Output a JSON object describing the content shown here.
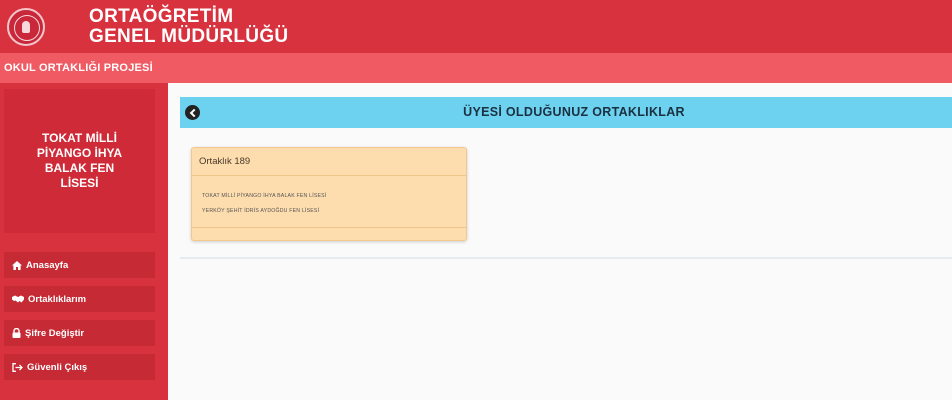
{
  "header": {
    "org_line1": "ORTAÖĞRETİM",
    "org_line2": "GENEL MÜDÜRLÜĞÜ",
    "logo_icon": "meb-seal-icon",
    "brand_color": "#d9323f"
  },
  "project_bar": {
    "title": "OKUL ORTAKLIĞI PROJESİ",
    "color": "#ef5a63"
  },
  "sidebar": {
    "school_name": "TOKAT MİLLİ PİYANGO İHYA BALAK FEN LİSESİ",
    "items": [
      {
        "label": "Anasayfa",
        "icon": "home-icon"
      },
      {
        "label": "Ortaklıklarım",
        "icon": "handshake-icon"
      },
      {
        "label": "Şifre Değiştir",
        "icon": "lock-icon"
      },
      {
        "label": "Güvenli Çıkış",
        "icon": "logout-icon"
      }
    ]
  },
  "main": {
    "title": "ÜYESİ OLDUĞUNUZ ORTAKLIKLAR",
    "back_icon": "back-arrow-icon",
    "header_color": "#6dd2f0",
    "partnership": {
      "name": "Ortaklık 189",
      "schools": [
        "TOKAT MİLLİ PİYANGO İHYA BALAK FEN LİSESİ",
        "YERKÖY ŞEHİT İDRİS AYDOĞDU FEN LİSESİ"
      ],
      "card_color": "#fddcae"
    }
  }
}
